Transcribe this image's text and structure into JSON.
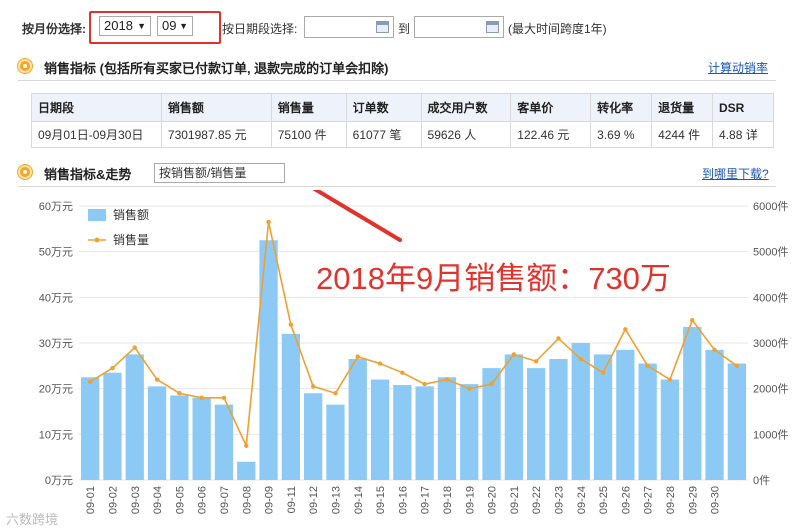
{
  "filter": {
    "month_label": "按月份选择:",
    "year_value": "2018",
    "month_value": "09",
    "date_label": "按日期段选择:",
    "to_label": "到",
    "max_label": "(最大时间跨度1年)"
  },
  "metrics_section": {
    "title": "销售指标 (包括所有买家已付款订单, 退款完成的订单会扣除)",
    "link": "计算动销率",
    "headers": [
      "日期段",
      "销售额",
      "销售量",
      "订单数",
      "成交用户数",
      "客单价",
      "转化率",
      "退货量",
      "DSR"
    ],
    "row": [
      "09月01日-09月30日",
      "7301987.85  元",
      "75100  件",
      "61077  笔",
      "59626  人",
      "122.46  元",
      "3.69  %",
      "4244  件",
      "4.88  详"
    ]
  },
  "trend_section": {
    "title": "销售指标&走势",
    "select_value": "按销售额/销售量",
    "link": "到哪里下载?"
  },
  "annotation": "2018年9月销售额：730万",
  "watermark": "六数跨境",
  "colors": {
    "bar": "#8ccaf5",
    "line": "#f0a030",
    "annotation": "#e0332c",
    "link": "#1a56b8"
  },
  "chart_data": {
    "type": "bar",
    "categories": [
      "09-01",
      "09-02",
      "09-03",
      "09-04",
      "09-05",
      "09-06",
      "09-07",
      "09-08",
      "09-09",
      "09-11",
      "09-12",
      "09-13",
      "09-14",
      "09-15",
      "09-16",
      "09-17",
      "09-18",
      "09-19",
      "09-20",
      "09-21",
      "09-22",
      "09-23",
      "09-24",
      "09-25",
      "09-26",
      "09-27",
      "09-28",
      "09-29",
      "09-30"
    ],
    "series": [
      {
        "name": "销售额",
        "type": "bar",
        "axis": "left",
        "values": [
          22.5,
          23.5,
          27.5,
          20.5,
          18.5,
          18,
          16.5,
          4,
          52.5,
          32,
          19,
          16.5,
          26.5,
          22,
          20.8,
          20.5,
          22.5,
          21,
          24.5,
          27.5,
          24.5,
          26.5,
          30,
          27.5,
          28.5,
          25.5,
          22,
          33.5,
          28.5,
          25.5
        ]
      },
      {
        "name": "销售量",
        "type": "line",
        "axis": "right",
        "values": [
          2150,
          2450,
          2900,
          2200,
          1900,
          1800,
          1800,
          750,
          5650,
          3400,
          2050,
          1900,
          2700,
          2550,
          2350,
          2100,
          2200,
          2000,
          2100,
          2750,
          2600,
          3100,
          2650,
          2350,
          3300,
          2500,
          2200,
          3500,
          2850,
          2500
        ]
      }
    ],
    "y_left": {
      "ticks": [
        "0万元",
        "10万元",
        "20万元",
        "30万元",
        "40万元",
        "50万元",
        "60万元"
      ],
      "range": [
        0,
        60
      ]
    },
    "y_right": {
      "ticks": [
        "0件",
        "1000件",
        "2000件",
        "3000件",
        "4000件",
        "5000件",
        "6000件"
      ],
      "range": [
        0,
        6000
      ]
    },
    "legend": "top-left",
    "grid": true
  }
}
